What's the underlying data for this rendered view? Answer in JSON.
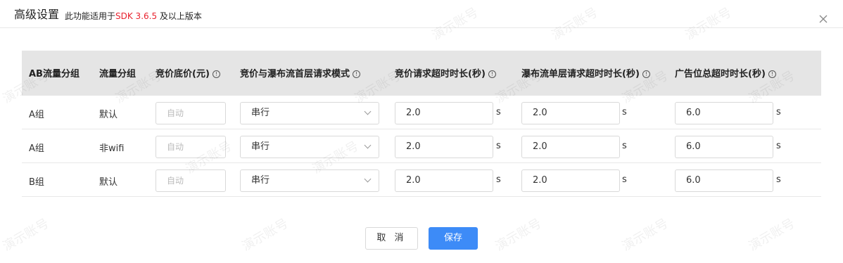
{
  "dialog": {
    "title": "高级设置",
    "subtitle_prefix": "此功能适用于",
    "subtitle_highlight": "SDK 3.6.5",
    "subtitle_suffix": " 及以上版本"
  },
  "columns": [
    "AB流量分组",
    "流量分组",
    "竞价底价(元)",
    "竞价与瀑布流首层请求模式",
    "竞价请求超时时长(秒)",
    "瀑布流单层请求超时时长(秒)",
    "广告位总超时时长(秒)"
  ],
  "info_glyph": "!",
  "rows": [
    {
      "ab_group": "A组",
      "flow_group": "默认",
      "floor_price_placeholder": "自动",
      "mode": "串行",
      "bid_timeout": "2.0",
      "layer_timeout": "2.0",
      "total_timeout": "6.0"
    },
    {
      "ab_group": "A组",
      "flow_group": "非wifi",
      "floor_price_placeholder": "自动",
      "mode": "串行",
      "bid_timeout": "2.0",
      "layer_timeout": "2.0",
      "total_timeout": "6.0"
    },
    {
      "ab_group": "B组",
      "flow_group": "默认",
      "floor_price_placeholder": "自动",
      "mode": "串行",
      "bid_timeout": "2.0",
      "layer_timeout": "2.0",
      "total_timeout": "6.0"
    }
  ],
  "unit": "s",
  "buttons": {
    "cancel": "取 消",
    "save": "保存"
  },
  "watermark": "演示账号",
  "colors": {
    "primary": "#3d8bf7",
    "highlight": "#e8232f",
    "header_bg": "#e5e5e5"
  }
}
